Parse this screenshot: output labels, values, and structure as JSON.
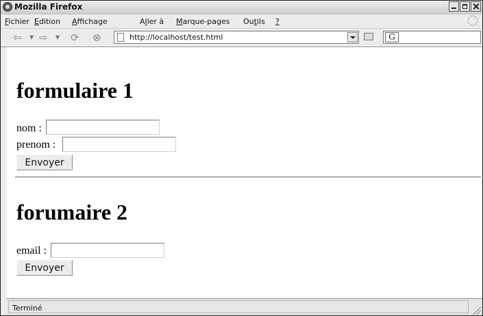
{
  "window": {
    "title": "Mozilla Firefox"
  },
  "menu": [
    {
      "label": "Fichier",
      "pre": "",
      "ul": "F",
      "post": "ichier"
    },
    {
      "label": "Edition",
      "pre": "",
      "ul": "E",
      "post": "dition"
    },
    {
      "label": "Affichage",
      "pre": "",
      "ul": "A",
      "post": "ffichage"
    },
    {
      "label": "Aller à",
      "pre": "A",
      "ul": "l",
      "post": "ler à"
    },
    {
      "label": "Marque-pages",
      "pre": "",
      "ul": "M",
      "post": "arque-pages"
    },
    {
      "label": "Outils",
      "pre": "Ou",
      "ul": "t",
      "post": "ils"
    },
    {
      "label": "?",
      "pre": "",
      "ul": "?",
      "post": ""
    }
  ],
  "nav": {
    "url": "http://localhost/test.html"
  },
  "page": {
    "form1": {
      "heading": "formulaire 1",
      "nom_label": "nom :",
      "nom_value": "",
      "prenom_label": "prenom :",
      "prenom_value": "",
      "submit": "Envoyer"
    },
    "form2": {
      "heading": "forumaire 2",
      "email_label": "email :",
      "email_value": "",
      "submit": "Envoyer"
    }
  },
  "status": {
    "text": "Terminé"
  }
}
